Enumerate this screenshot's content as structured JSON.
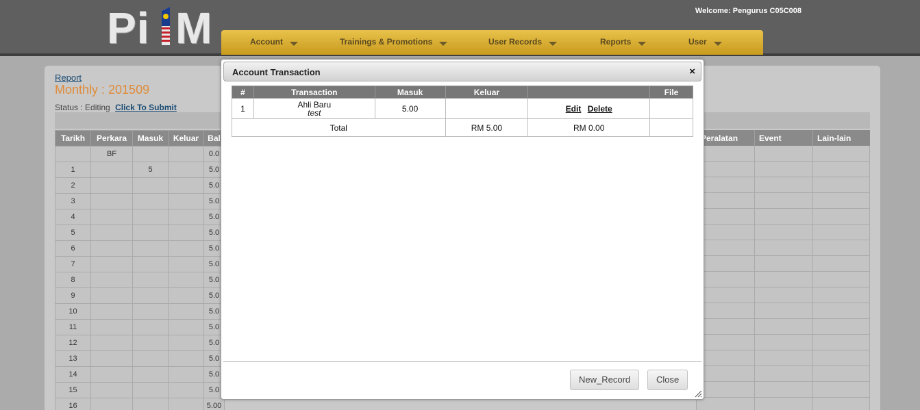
{
  "header": {
    "logo_text": "Pi1M",
    "welcome": "Welcome: Pengurus C05C008",
    "nav": [
      {
        "label": "Account"
      },
      {
        "label": "Trainings & Promotions"
      },
      {
        "label": "User Records"
      },
      {
        "label": "Reports"
      },
      {
        "label": "User"
      }
    ]
  },
  "page": {
    "breadcrumb": "Report",
    "title": "Monthly : 201509",
    "status_label": "Status : Editing",
    "submit_link": "Click To Submit",
    "columns": [
      "Tarikh",
      "Perkara",
      "Masuk",
      "Keluar",
      "Bal"
    ],
    "right_columns": [
      "Peralatan",
      "Event",
      "Lain-lain"
    ],
    "rows": [
      {
        "tarikh": "",
        "perkara": "BF",
        "masuk": "",
        "keluar": "",
        "bal": "0.0"
      },
      {
        "tarikh": "1",
        "perkara": "",
        "masuk": "5",
        "keluar": "",
        "bal": "5.0"
      },
      {
        "tarikh": "2",
        "perkara": "",
        "masuk": "",
        "keluar": "",
        "bal": "5.0"
      },
      {
        "tarikh": "3",
        "perkara": "",
        "masuk": "",
        "keluar": "",
        "bal": "5.0"
      },
      {
        "tarikh": "4",
        "perkara": "",
        "masuk": "",
        "keluar": "",
        "bal": "5.0"
      },
      {
        "tarikh": "5",
        "perkara": "",
        "masuk": "",
        "keluar": "",
        "bal": "5.0"
      },
      {
        "tarikh": "6",
        "perkara": "",
        "masuk": "",
        "keluar": "",
        "bal": "5.0"
      },
      {
        "tarikh": "7",
        "perkara": "",
        "masuk": "",
        "keluar": "",
        "bal": "5.0"
      },
      {
        "tarikh": "8",
        "perkara": "",
        "masuk": "",
        "keluar": "",
        "bal": "5.0"
      },
      {
        "tarikh": "9",
        "perkara": "",
        "masuk": "",
        "keluar": "",
        "bal": "5.0"
      },
      {
        "tarikh": "10",
        "perkara": "",
        "masuk": "",
        "keluar": "",
        "bal": "5.0"
      },
      {
        "tarikh": "11",
        "perkara": "",
        "masuk": "",
        "keluar": "",
        "bal": "5.0"
      },
      {
        "tarikh": "12",
        "perkara": "",
        "masuk": "",
        "keluar": "",
        "bal": "5.0"
      },
      {
        "tarikh": "13",
        "perkara": "",
        "masuk": "",
        "keluar": "",
        "bal": "5.0"
      },
      {
        "tarikh": "14",
        "perkara": "",
        "masuk": "",
        "keluar": "",
        "bal": "5.0"
      },
      {
        "tarikh": "15",
        "perkara": "",
        "masuk": "",
        "keluar": "",
        "bal": "5.0"
      },
      {
        "tarikh": "16",
        "perkara": "",
        "masuk": "",
        "keluar": "",
        "bal": "5.00"
      }
    ]
  },
  "modal": {
    "title": "Account Transaction",
    "close_icon": "×",
    "columns": [
      "#",
      "Transaction",
      "Masuk",
      "Keluar",
      "",
      "File"
    ],
    "rows": [
      {
        "num": "1",
        "transaction": "Ahli Baru",
        "note": "test",
        "masuk": "5.00",
        "keluar": "",
        "edit": "Edit",
        "delete": "Delete",
        "file": ""
      }
    ],
    "total": {
      "label": "Total",
      "masuk": "RM 5.00",
      "keluar": "RM 0.00"
    },
    "buttons": {
      "new_record": "New_Record",
      "close": "Close"
    }
  }
}
